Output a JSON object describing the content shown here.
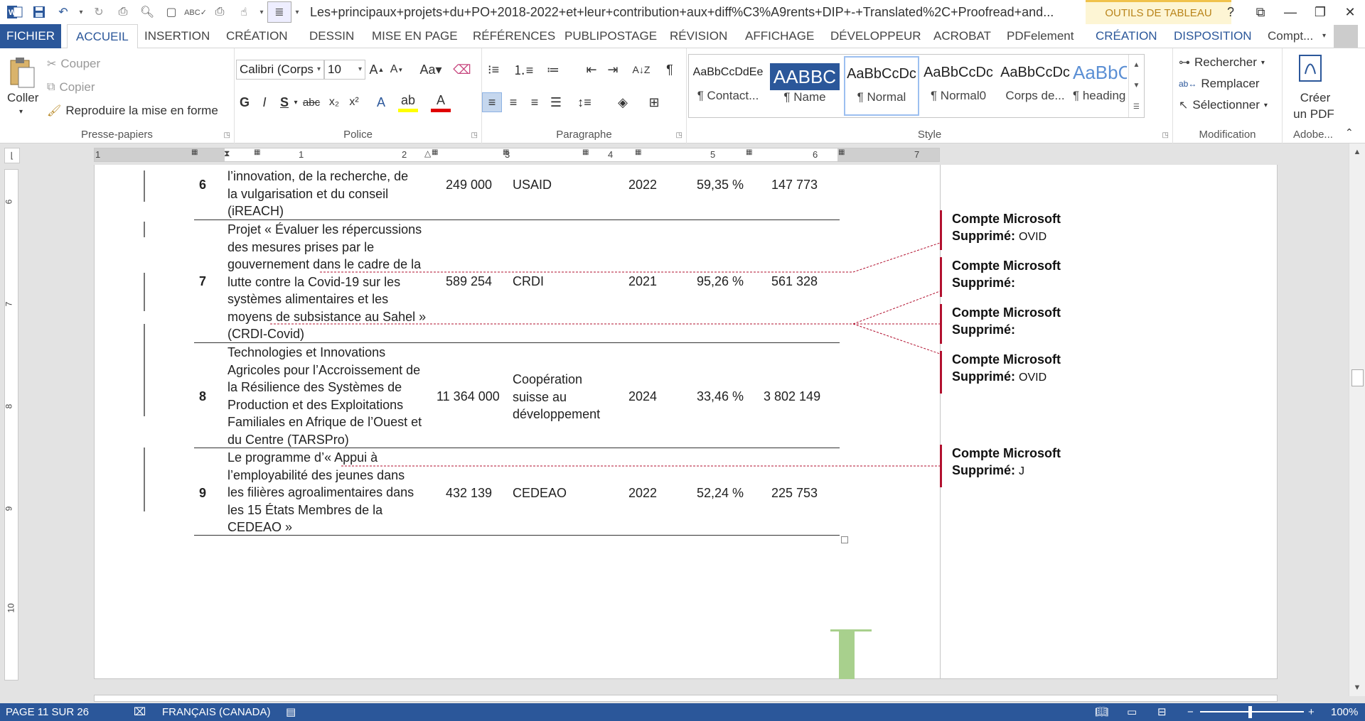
{
  "titlebar": {
    "title": "Les+principaux+projets+du+PO+2018-2022+et+leur+contribution+aux+diff%C3%A9rents+DIP+-+Translated%2C+Proofread+and...",
    "table_tools": "OUTILS DE TABLEAU",
    "help": "?"
  },
  "tabs": {
    "file": "FICHIER",
    "home": "ACCUEIL",
    "insert": "INSERTION",
    "design": "CRÉATION",
    "draw": "DESSIN",
    "layout": "MISE EN PAGE",
    "references": "RÉFÉRENCES",
    "mailings": "PUBLIPOSTAGE",
    "review": "RÉVISION",
    "view": "AFFICHAGE",
    "developer": "DÉVELOPPEUR",
    "acrobat": "ACROBAT",
    "pdfelement": "PDFelement",
    "table_design": "CRÉATION",
    "table_layout": "DISPOSITION",
    "account": "Compt..."
  },
  "ribbon": {
    "clipboard": {
      "label": "Presse-papiers",
      "paste": "Coller",
      "cut": "Couper",
      "copy": "Copier",
      "format_painter": "Reproduire la mise en forme"
    },
    "font": {
      "label": "Police",
      "name": "Calibri (Corps",
      "size": "10"
    },
    "paragraph": {
      "label": "Paragraphe"
    },
    "styles": {
      "label": "Style",
      "items": [
        {
          "preview": "AaBbCcDdEe",
          "name": "¶ Contact..."
        },
        {
          "preview": "AABBC",
          "name": "¶ Name"
        },
        {
          "preview": "AaBbCcDc",
          "name": "¶ Normal"
        },
        {
          "preview": "AaBbCcDc",
          "name": "¶ Normal0"
        },
        {
          "preview": "AaBbCcDc",
          "name": "Corps de..."
        },
        {
          "preview": "AaBbCc",
          "name": "¶ heading..."
        }
      ]
    },
    "editing": {
      "label": "Modification",
      "find": "Rechercher",
      "replace": "Remplacer",
      "select": "Sélectionner"
    },
    "adobe": {
      "label": "Adobe...",
      "create_pdf_1": "Créer",
      "create_pdf_2": "un PDF"
    }
  },
  "ruler": {
    "h": [
      "1",
      "1",
      "2",
      "3",
      "4",
      "5",
      "6",
      "7"
    ],
    "v": [
      "6",
      "7",
      "8",
      "9",
      "10"
    ]
  },
  "table": {
    "rows": [
      {
        "num": "6",
        "title": [
          "l’innovation, de la recherche, de",
          "la vulgarisation et du conseil",
          "(iREACH)"
        ],
        "amount": "249 000",
        "donor": [
          "USAID"
        ],
        "year": "2022",
        "pct": "59,35 %",
        "contrib": "147 773"
      },
      {
        "num": "7",
        "title": [
          "Projet « Évaluer les répercussions",
          "des mesures prises par le",
          "gouvernement dans le cadre de la",
          "lutte contre la Covid-19 sur les",
          "systèmes alimentaires et les",
          "moyens de subsistance au Sahel »",
          "(CRDI-Covid)"
        ],
        "amount": "589 254",
        "donor": [
          "CRDI"
        ],
        "year": "2021",
        "pct": "95,26 %",
        "contrib": "561 328"
      },
      {
        "num": "8",
        "title": [
          "Technologies et Innovations",
          "Agricoles pour l’Accroissement de",
          "la Résilience des Systèmes de",
          "Production et des Exploitations",
          "Familiales en Afrique de l’Ouest et",
          "du Centre (TARSPro)"
        ],
        "amount": "11 364 000",
        "donor": [
          "Coopération",
          "suisse au",
          "développement"
        ],
        "year": "2024",
        "pct": "33,46 %",
        "contrib": "3 802 149"
      },
      {
        "num": "9",
        "title": [
          "Le programme d’« Appui à",
          "l’employabilité des jeunes dans",
          "les filières agroalimentaires dans",
          "les 15 États Membres de la",
          "CEDEAO »"
        ],
        "amount": "432 139",
        "donor": [
          "CEDEAO"
        ],
        "year": "2022",
        "pct": "52,24 %",
        "contrib": "225 753"
      }
    ]
  },
  "comments": [
    {
      "author": "Compte Microsoft",
      "label": "Supprimé:",
      "value": "OVID"
    },
    {
      "author": "Compte Microsoft",
      "label": "Supprimé:",
      "value": ""
    },
    {
      "author": "Compte Microsoft",
      "label": "Supprimé:",
      "value": ""
    },
    {
      "author": "Compte Microsoft",
      "label": "Supprimé:",
      "value": "OVID"
    },
    {
      "author": "Compte Microsoft",
      "label": "Supprimé:",
      "value": "J"
    }
  ],
  "statusbar": {
    "page": "PAGE 11 SUR 26",
    "language": "FRANÇAIS (CANADA)",
    "zoom": "100%"
  },
  "colors": {
    "accent": "#2b579a",
    "revision": "#b2102f",
    "table_tools": "#b9841a"
  }
}
